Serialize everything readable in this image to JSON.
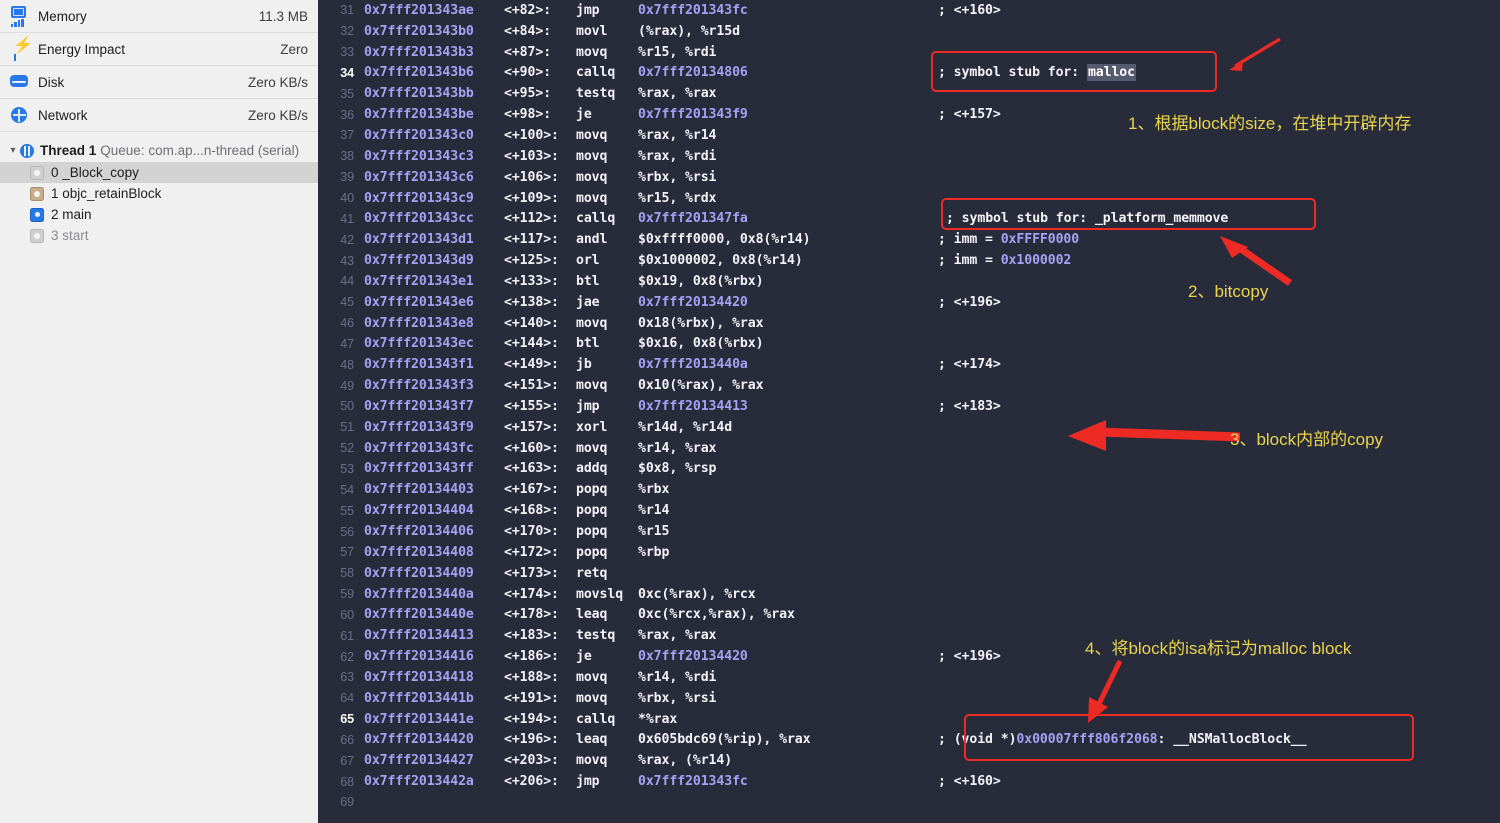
{
  "sidebar": {
    "gauges": [
      {
        "icon": "memory-chip-icon",
        "label": "Memory",
        "value": "11.3 MB"
      },
      {
        "icon": "energy-bolt-icon",
        "label": "Energy Impact",
        "value": "Zero"
      },
      {
        "icon": "disk-icon",
        "label": "Disk",
        "value": "Zero KB/s"
      },
      {
        "icon": "network-globe-icon",
        "label": "Network",
        "value": "Zero KB/s"
      }
    ],
    "thread": {
      "chevron": "disclosure-open-icon",
      "icon": "thread-icon",
      "name": "Thread 1",
      "queue": "Queue: com.ap...n-thread (serial)"
    },
    "frames": [
      {
        "icon": "frame-gray-icon",
        "index": "0",
        "label": "_Block_copy",
        "selected": true,
        "dim": false
      },
      {
        "icon": "frame-tan-icon",
        "index": "1",
        "label": "objc_retainBlock",
        "selected": false,
        "dim": false
      },
      {
        "icon": "frame-blue-icon",
        "index": "2",
        "label": "main",
        "selected": false,
        "dim": false
      },
      {
        "icon": "frame-gray-icon",
        "index": "3",
        "label": "start",
        "selected": false,
        "dim": true
      }
    ]
  },
  "disassembly": {
    "lines": [
      {
        "no": "31",
        "cur": false,
        "addr": "0x7fff201343ae",
        "off": "<+82>:",
        "mnem": "jmp",
        "ops": "0x7fff201343fc",
        "ops_hex": true,
        "comment": "; <+160>",
        "comment_kind": "off"
      },
      {
        "no": "32",
        "cur": false,
        "addr": "0x7fff201343b0",
        "off": "<+84>:",
        "mnem": "movl",
        "ops": "(%rax), %r15d",
        "ops_hex": false,
        "comment": "",
        "comment_kind": ""
      },
      {
        "no": "33",
        "cur": false,
        "addr": "0x7fff201343b3",
        "off": "<+87>:",
        "mnem": "movq",
        "ops": "%r15, %rdi",
        "ops_hex": false,
        "comment": "",
        "comment_kind": ""
      },
      {
        "no": "34",
        "cur": true,
        "addr": "0x7fff201343b6",
        "off": "<+90>:",
        "mnem": "callq",
        "ops": "0x7fff20134806",
        "ops_hex": true,
        "comment": "; symbol stub for: malloc",
        "comment_kind": "stub-malloc"
      },
      {
        "no": "35",
        "cur": false,
        "addr": "0x7fff201343bb",
        "off": "<+95>:",
        "mnem": "testq",
        "ops": "%rax, %rax",
        "ops_hex": false,
        "comment": "",
        "comment_kind": ""
      },
      {
        "no": "36",
        "cur": false,
        "addr": "0x7fff201343be",
        "off": "<+98>:",
        "mnem": "je",
        "ops": "0x7fff201343f9",
        "ops_hex": true,
        "comment": "; <+157>",
        "comment_kind": "off"
      },
      {
        "no": "37",
        "cur": false,
        "addr": "0x7fff201343c0",
        "off": "<+100>:",
        "mnem": "movq",
        "ops": "%rax, %r14",
        "ops_hex": false,
        "comment": "",
        "comment_kind": ""
      },
      {
        "no": "38",
        "cur": false,
        "addr": "0x7fff201343c3",
        "off": "<+103>:",
        "mnem": "movq",
        "ops": "%rax, %rdi",
        "ops_hex": false,
        "comment": "",
        "comment_kind": ""
      },
      {
        "no": "39",
        "cur": false,
        "addr": "0x7fff201343c6",
        "off": "<+106>:",
        "mnem": "movq",
        "ops": "%rbx, %rsi",
        "ops_hex": false,
        "comment": "",
        "comment_kind": ""
      },
      {
        "no": "40",
        "cur": false,
        "addr": "0x7fff201343c9",
        "off": "<+109>:",
        "mnem": "movq",
        "ops": "%r15, %rdx",
        "ops_hex": false,
        "comment": "",
        "comment_kind": ""
      },
      {
        "no": "41",
        "cur": false,
        "addr": "0x7fff201343cc",
        "off": "<+112>:",
        "mnem": "callq",
        "ops": "0x7fff201347fa",
        "ops_hex": true,
        "comment": "; symbol stub for: _platform_memmove",
        "comment_kind": "stub-memmove"
      },
      {
        "no": "42",
        "cur": false,
        "addr": "0x7fff201343d1",
        "off": "<+117>:",
        "mnem": "andl",
        "ops": "$0xffff0000, 0x8(%r14)",
        "ops_hex": false,
        "comment": "; imm = 0xFFFF0000",
        "comment_kind": "imm"
      },
      {
        "no": "43",
        "cur": false,
        "addr": "0x7fff201343d9",
        "off": "<+125>:",
        "mnem": "orl",
        "ops": "$0x1000002, 0x8(%r14)",
        "ops_hex": false,
        "comment": "; imm = 0x1000002",
        "comment_kind": "imm"
      },
      {
        "no": "44",
        "cur": false,
        "addr": "0x7fff201343e1",
        "off": "<+133>:",
        "mnem": "btl",
        "ops": "$0x19, 0x8(%rbx)",
        "ops_hex": false,
        "comment": "",
        "comment_kind": ""
      },
      {
        "no": "45",
        "cur": false,
        "addr": "0x7fff201343e6",
        "off": "<+138>:",
        "mnem": "jae",
        "ops": "0x7fff20134420",
        "ops_hex": true,
        "comment": "; <+196>",
        "comment_kind": "off"
      },
      {
        "no": "46",
        "cur": false,
        "addr": "0x7fff201343e8",
        "off": "<+140>:",
        "mnem": "movq",
        "ops": "0x18(%rbx), %rax",
        "ops_hex": false,
        "comment": "",
        "comment_kind": ""
      },
      {
        "no": "47",
        "cur": false,
        "addr": "0x7fff201343ec",
        "off": "<+144>:",
        "mnem": "btl",
        "ops": "$0x16, 0x8(%rbx)",
        "ops_hex": false,
        "comment": "",
        "comment_kind": ""
      },
      {
        "no": "48",
        "cur": false,
        "addr": "0x7fff201343f1",
        "off": "<+149>:",
        "mnem": "jb",
        "ops": "0x7fff2013440a",
        "ops_hex": true,
        "comment": "; <+174>",
        "comment_kind": "off"
      },
      {
        "no": "49",
        "cur": false,
        "addr": "0x7fff201343f3",
        "off": "<+151>:",
        "mnem": "movq",
        "ops": "0x10(%rax), %rax",
        "ops_hex": false,
        "comment": "",
        "comment_kind": ""
      },
      {
        "no": "50",
        "cur": false,
        "addr": "0x7fff201343f7",
        "off": "<+155>:",
        "mnem": "jmp",
        "ops": "0x7fff20134413",
        "ops_hex": true,
        "comment": "; <+183>",
        "comment_kind": "off"
      },
      {
        "no": "51",
        "cur": false,
        "addr": "0x7fff201343f9",
        "off": "<+157>:",
        "mnem": "xorl",
        "ops": "%r14d, %r14d",
        "ops_hex": false,
        "comment": "",
        "comment_kind": ""
      },
      {
        "no": "52",
        "cur": false,
        "addr": "0x7fff201343fc",
        "off": "<+160>:",
        "mnem": "movq",
        "ops": "%r14, %rax",
        "ops_hex": false,
        "comment": "",
        "comment_kind": ""
      },
      {
        "no": "53",
        "cur": false,
        "addr": "0x7fff201343ff",
        "off": "<+163>:",
        "mnem": "addq",
        "ops": "$0x8, %rsp",
        "ops_hex": false,
        "comment": "",
        "comment_kind": ""
      },
      {
        "no": "54",
        "cur": false,
        "addr": "0x7fff20134403",
        "off": "<+167>:",
        "mnem": "popq",
        "ops": "%rbx",
        "ops_hex": false,
        "comment": "",
        "comment_kind": ""
      },
      {
        "no": "55",
        "cur": false,
        "addr": "0x7fff20134404",
        "off": "<+168>:",
        "mnem": "popq",
        "ops": "%r14",
        "ops_hex": false,
        "comment": "",
        "comment_kind": ""
      },
      {
        "no": "56",
        "cur": false,
        "addr": "0x7fff20134406",
        "off": "<+170>:",
        "mnem": "popq",
        "ops": "%r15",
        "ops_hex": false,
        "comment": "",
        "comment_kind": ""
      },
      {
        "no": "57",
        "cur": false,
        "addr": "0x7fff20134408",
        "off": "<+172>:",
        "mnem": "popq",
        "ops": "%rbp",
        "ops_hex": false,
        "comment": "",
        "comment_kind": ""
      },
      {
        "no": "58",
        "cur": false,
        "addr": "0x7fff20134409",
        "off": "<+173>:",
        "mnem": "retq",
        "ops": "",
        "ops_hex": false,
        "comment": "",
        "comment_kind": ""
      },
      {
        "no": "59",
        "cur": false,
        "addr": "0x7fff2013440a",
        "off": "<+174>:",
        "mnem": "movslq",
        "ops": "0xc(%rax), %rcx",
        "ops_hex": false,
        "comment": "",
        "comment_kind": ""
      },
      {
        "no": "60",
        "cur": false,
        "addr": "0x7fff2013440e",
        "off": "<+178>:",
        "mnem": "leaq",
        "ops": "0xc(%rcx,%rax), %rax",
        "ops_hex": false,
        "comment": "",
        "comment_kind": ""
      },
      {
        "no": "61",
        "cur": false,
        "addr": "0x7fff20134413",
        "off": "<+183>:",
        "mnem": "testq",
        "ops": "%rax, %rax",
        "ops_hex": false,
        "comment": "",
        "comment_kind": ""
      },
      {
        "no": "62",
        "cur": false,
        "addr": "0x7fff20134416",
        "off": "<+186>:",
        "mnem": "je",
        "ops": "0x7fff20134420",
        "ops_hex": true,
        "comment": "; <+196>",
        "comment_kind": "off"
      },
      {
        "no": "63",
        "cur": false,
        "addr": "0x7fff20134418",
        "off": "<+188>:",
        "mnem": "movq",
        "ops": "%r14, %rdi",
        "ops_hex": false,
        "comment": "",
        "comment_kind": ""
      },
      {
        "no": "64",
        "cur": false,
        "addr": "0x7fff2013441b",
        "off": "<+191>:",
        "mnem": "movq",
        "ops": "%rbx, %rsi",
        "ops_hex": false,
        "comment": "",
        "comment_kind": ""
      },
      {
        "no": "65",
        "cur": true,
        "addr": "0x7fff2013441e",
        "off": "<+194>:",
        "mnem": "callq",
        "ops": "*%rax",
        "ops_hex": false,
        "comment": "",
        "comment_kind": ""
      },
      {
        "no": "66",
        "cur": false,
        "addr": "0x7fff20134420",
        "off": "<+196>:",
        "mnem": "leaq",
        "ops": "0x605bdc69(%rip), %rax",
        "ops_hex": false,
        "comment": "; (void *)0x00007fff806f2068: __NSMallocBlock__",
        "comment_kind": "nsblock"
      },
      {
        "no": "67",
        "cur": false,
        "addr": "0x7fff20134427",
        "off": "<+203>:",
        "mnem": "movq",
        "ops": "%rax, (%r14)",
        "ops_hex": false,
        "comment": "",
        "comment_kind": ""
      },
      {
        "no": "68",
        "cur": false,
        "addr": "0x7fff2013442a",
        "off": "<+206>:",
        "mnem": "jmp",
        "ops": "0x7fff201343fc",
        "ops_hex": true,
        "comment": "; <+160>",
        "comment_kind": "off"
      },
      {
        "no": "69",
        "cur": false,
        "addr": "",
        "off": "",
        "mnem": "",
        "ops": "",
        "ops_hex": false,
        "comment": "",
        "comment_kind": ""
      }
    ]
  },
  "annotations": {
    "accent_red": "#ee2a24",
    "accent_yellow": "#e8d44d",
    "notes": [
      {
        "id": "note-1",
        "text": "1、根据block的size，在堆中开辟内存"
      },
      {
        "id": "note-2",
        "text": "2、bitcopy"
      },
      {
        "id": "note-3",
        "text": "3、block内部的copy"
      },
      {
        "id": "note-4",
        "text": "4、将block的isa标记为malloc block"
      }
    ],
    "comment_parts": {
      "stub_prefix": "; symbol stub for: ",
      "malloc_symbol": "malloc",
      "memmove_symbol": "_platform_memmove",
      "nsblock_cast": "(void *)",
      "nsblock_addr": "0x00007fff806f2068",
      "nsblock_name": ": __NSMallocBlock__"
    }
  }
}
